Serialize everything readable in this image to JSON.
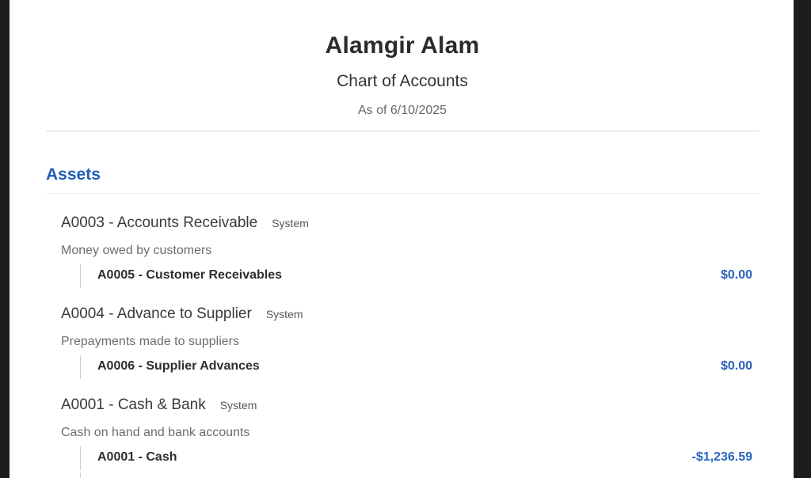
{
  "report": {
    "company_name": "Alamgir Alam",
    "title": "Chart of Accounts",
    "as_of": "As of 6/10/2025"
  },
  "sections": [
    {
      "title": "Assets",
      "groups": [
        {
          "title": "A0003 - Accounts Receivable",
          "badge": "System",
          "description": "Money owed by customers",
          "accounts": [
            {
              "name": "A0005 - Customer Receivables",
              "amount": "$0.00"
            }
          ]
        },
        {
          "title": "A0004 - Advance to Supplier",
          "badge": "System",
          "description": "Prepayments made to suppliers",
          "accounts": [
            {
              "name": "A0006 - Supplier Advances",
              "amount": "$0.00"
            }
          ]
        },
        {
          "title": "A0001 - Cash & Bank",
          "badge": "System",
          "description": "Cash on hand and bank accounts",
          "accounts": [
            {
              "name": "A0001 - Cash",
              "amount": "-$1,236.59"
            }
          ]
        }
      ]
    }
  ],
  "colors": {
    "section_title": "#1f5fb8",
    "amount": "#2a63bd",
    "background": "#ffffff",
    "frame": "#1c1c1c"
  }
}
